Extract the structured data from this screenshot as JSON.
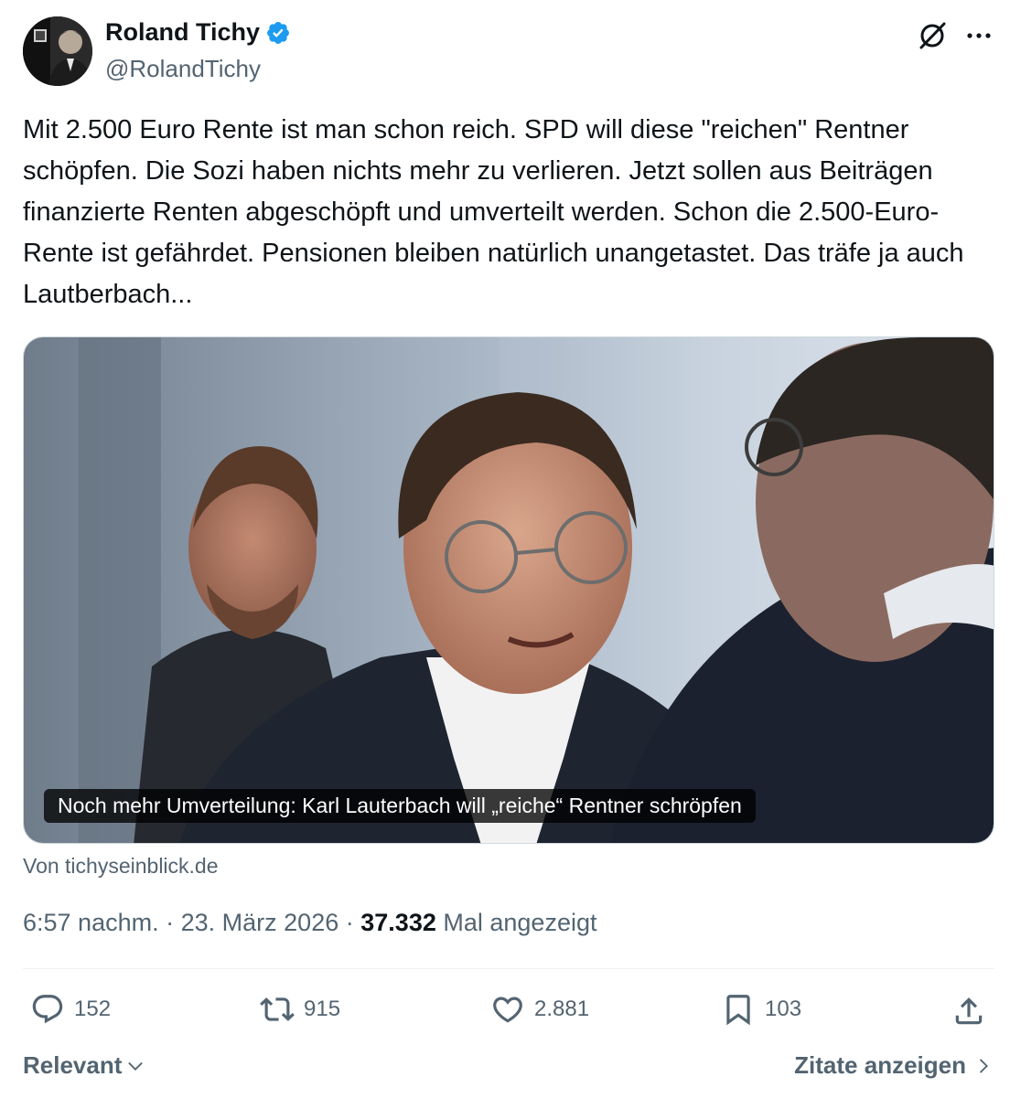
{
  "author": {
    "name": "Roland Tichy",
    "handle": "@RolandTichy",
    "verified_color": "#1d9bf0"
  },
  "tweet": {
    "text": "Mit 2.500 Euro Rente ist man schon reich. SPD will diese \"reichen\" Rentner schöpfen. Die Sozi haben nichts mehr zu verlieren. Jetzt sollen aus Beiträgen finanzierte Renten abgeschöpft und umverteilt werden. Schon die 2.500-Euro-Rente ist gefährdet. Pensionen bleiben natürlich unangetastet. Das träfe ja auch Lautberbach..."
  },
  "card": {
    "caption": "Noch mehr Umverteilung: Karl Lauterbach will „reiche“ Rentner schröpfen",
    "source": "Von tichyseinblick.de"
  },
  "meta": {
    "time": "6:57 nachm.",
    "separator": "·",
    "date": "23. März 2026",
    "views_count": "37.332",
    "views_label": "Mal angezeigt"
  },
  "actions": {
    "replies": "152",
    "reposts": "915",
    "likes": "2.881",
    "bookmarks": "103"
  },
  "footer": {
    "sort_label": "Relevant",
    "quotes_label": "Zitate anzeigen"
  },
  "icons": [
    "grok-icon",
    "more-icon",
    "verified-badge-icon",
    "reply-icon",
    "repost-icon",
    "like-icon",
    "bookmark-icon",
    "share-icon",
    "chevron-down-icon",
    "chevron-right-icon"
  ]
}
